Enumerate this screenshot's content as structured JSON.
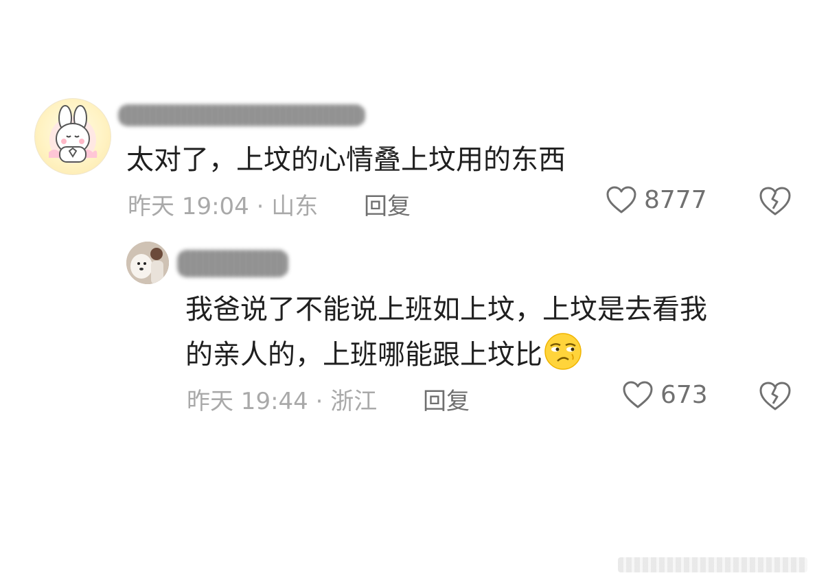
{
  "comments": [
    {
      "text": "太对了，上坟的心情叠上坟用的东西",
      "time_location": "昨天 19:04 · 山东",
      "reply_label": "回复",
      "likes": "8777"
    }
  ],
  "reply": {
    "text_line1": "我爸说了不能说上班如上坟，上坟是去看我",
    "text_line2": "的亲人的，上班哪能跟上坟比",
    "time_location": "昨天 19:44 · 浙江",
    "reply_label": "回复",
    "likes": "673",
    "emoji": "doubtful-face-emoji"
  },
  "colors": {
    "text": "#1f1f1f",
    "meta": "#a9a9a9",
    "action": "#6f6f6f"
  }
}
